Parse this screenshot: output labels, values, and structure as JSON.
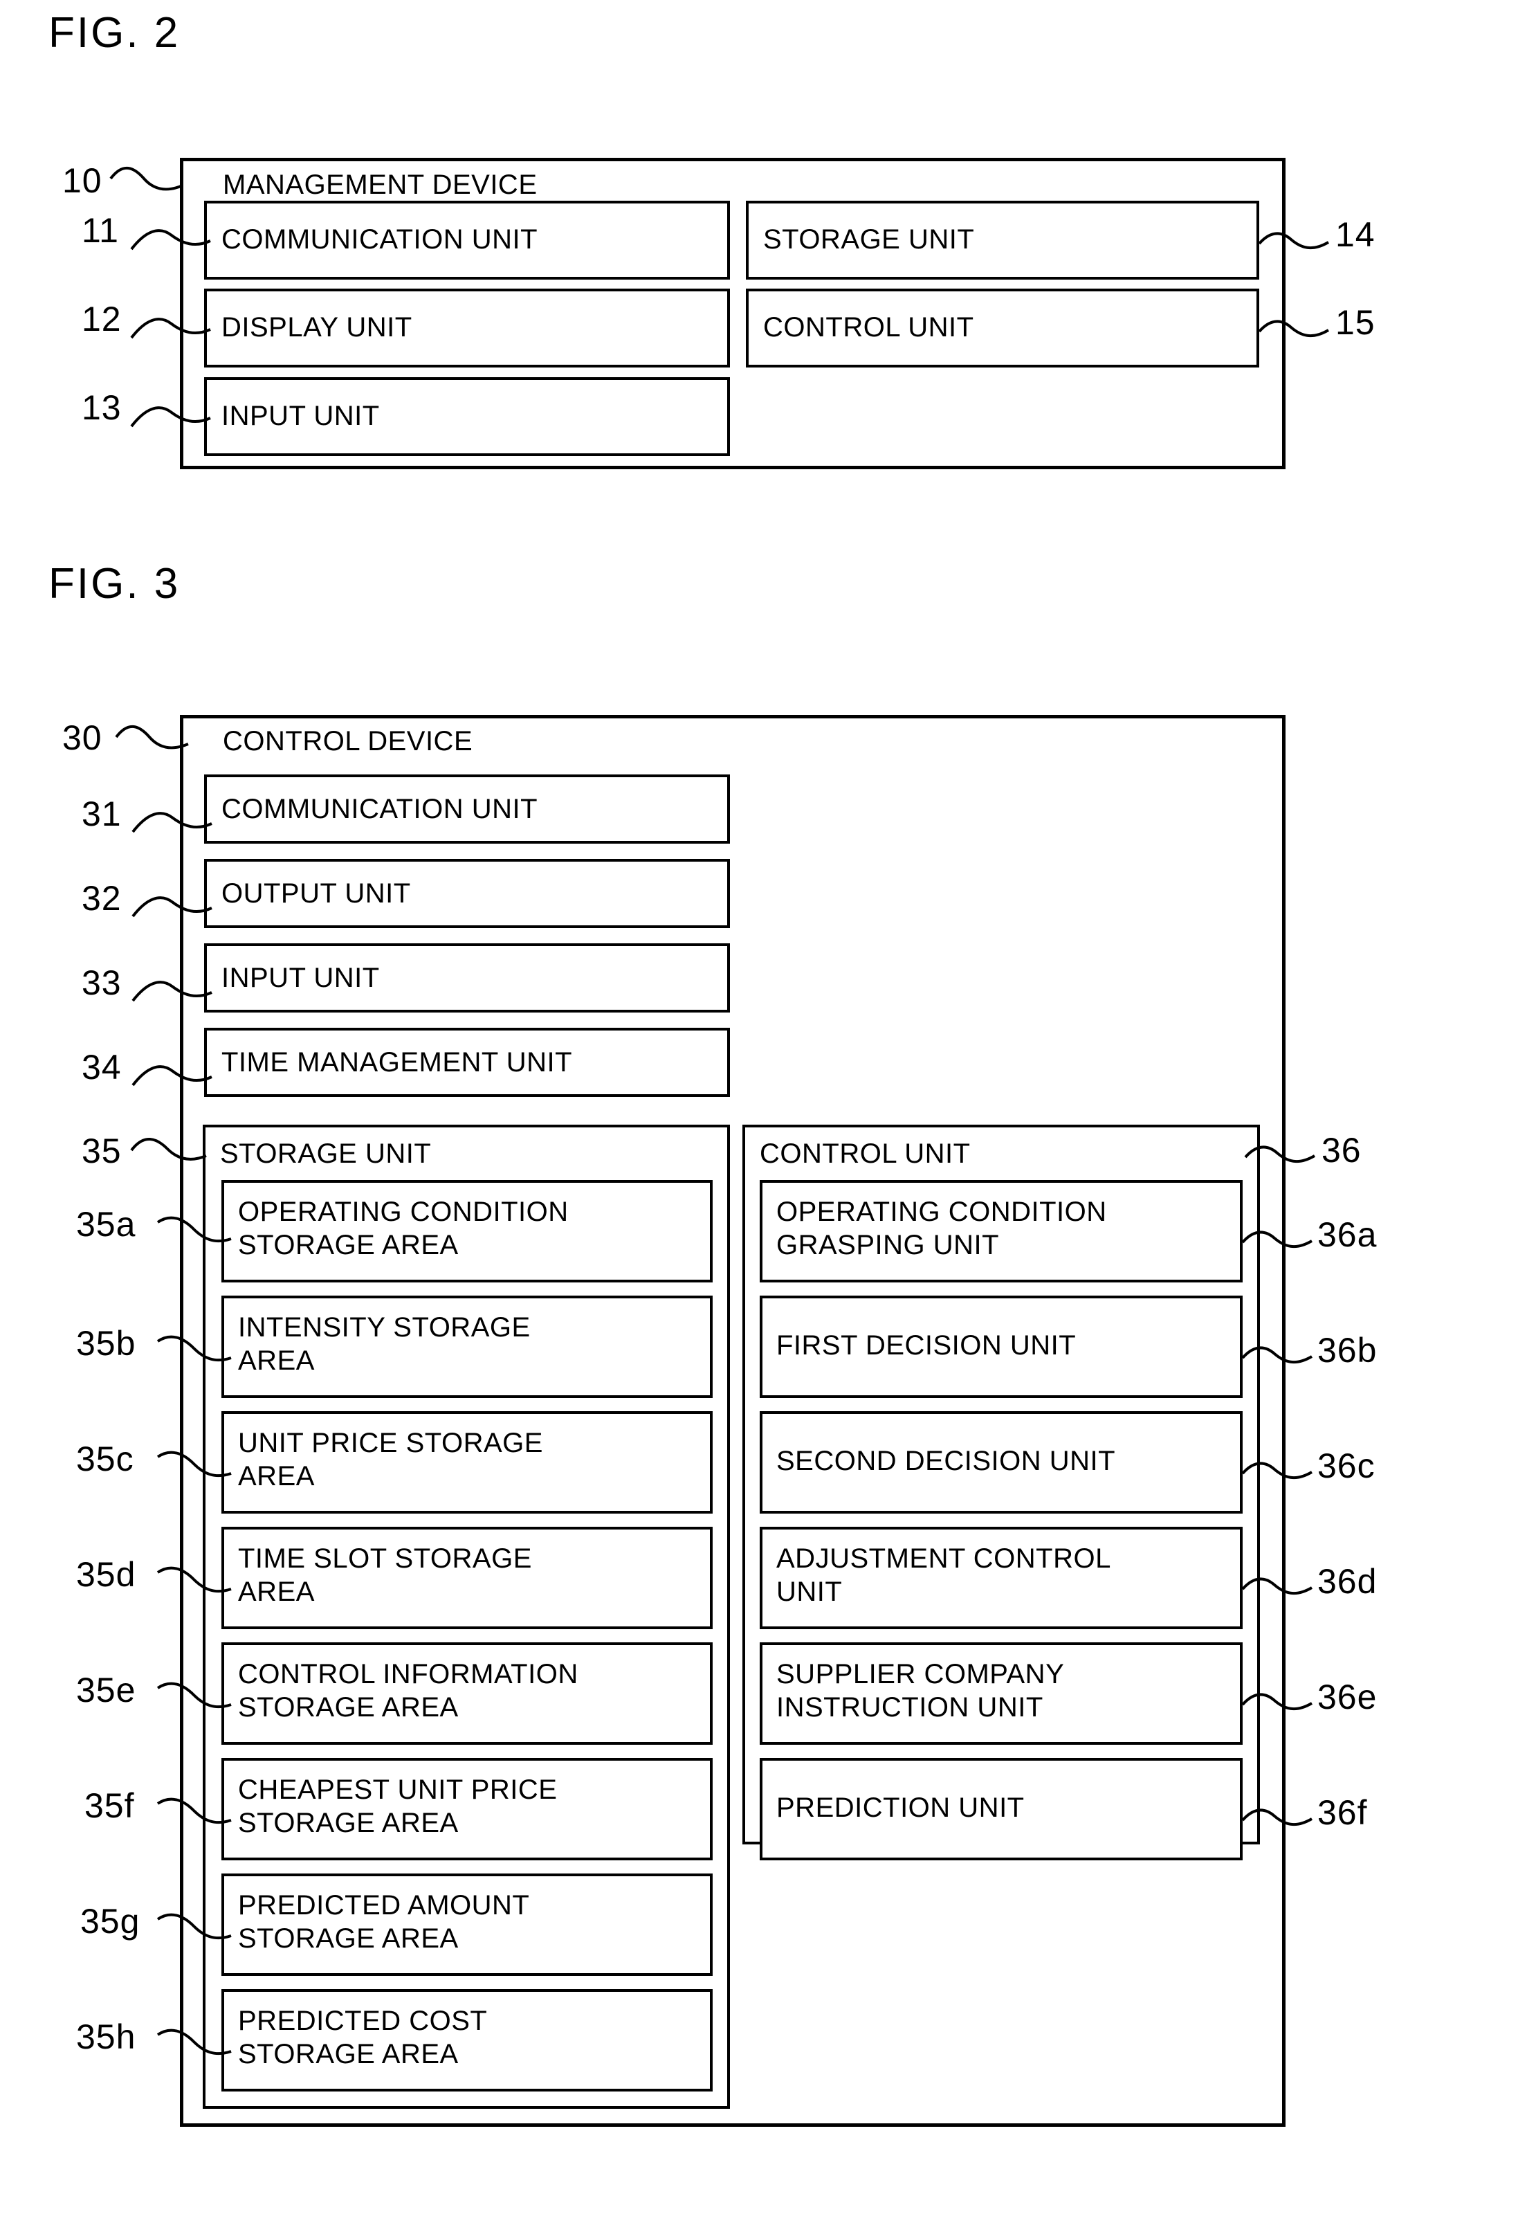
{
  "figures": [
    {
      "title": "FIG. 2",
      "device": {
        "ref": "10",
        "name": "MANAGEMENT DEVICE",
        "units": [
          {
            "ref": "11",
            "label": "COMMUNICATION UNIT",
            "column": "left"
          },
          {
            "ref": "12",
            "label": "DISPLAY UNIT",
            "column": "left"
          },
          {
            "ref": "13",
            "label": "INPUT UNIT",
            "column": "left"
          },
          {
            "ref": "14",
            "label": "STORAGE UNIT",
            "column": "right"
          },
          {
            "ref": "15",
            "label": "CONTROL UNIT",
            "column": "right"
          }
        ]
      }
    },
    {
      "title": "FIG. 3",
      "device": {
        "ref": "30",
        "name": "CONTROL DEVICE",
        "units": [
          {
            "ref": "31",
            "label": "COMMUNICATION UNIT"
          },
          {
            "ref": "32",
            "label": "OUTPUT UNIT"
          },
          {
            "ref": "33",
            "label": "INPUT UNIT"
          },
          {
            "ref": "34",
            "label": "TIME MANAGEMENT UNIT"
          }
        ],
        "storage_unit": {
          "ref": "35",
          "name": "STORAGE UNIT",
          "areas": [
            {
              "ref": "35a",
              "line1": "OPERATING CONDITION",
              "line2": "STORAGE AREA"
            },
            {
              "ref": "35b",
              "line1": "INTENSITY STORAGE",
              "line2": "AREA"
            },
            {
              "ref": "35c",
              "line1": "UNIT PRICE STORAGE",
              "line2": "AREA"
            },
            {
              "ref": "35d",
              "line1": "TIME SLOT STORAGE",
              "line2": "AREA"
            },
            {
              "ref": "35e",
              "line1": "CONTROL INFORMATION",
              "line2": "STORAGE AREA"
            },
            {
              "ref": "35f",
              "line1": "CHEAPEST UNIT PRICE",
              "line2": "STORAGE AREA"
            },
            {
              "ref": "35g",
              "line1": "PREDICTED AMOUNT",
              "line2": "STORAGE AREA"
            },
            {
              "ref": "35h",
              "line1": "PREDICTED COST",
              "line2": "STORAGE AREA"
            }
          ]
        },
        "control_unit": {
          "ref": "36",
          "name": "CONTROL UNIT",
          "units": [
            {
              "ref": "36a",
              "line1": "OPERATING CONDITION",
              "line2": "GRASPING UNIT"
            },
            {
              "ref": "36b",
              "line1": "FIRST DECISION UNIT",
              "line2": ""
            },
            {
              "ref": "36c",
              "line1": "SECOND DECISION UNIT",
              "line2": ""
            },
            {
              "ref": "36d",
              "line1": "ADJUSTMENT CONTROL",
              "line2": "UNIT"
            },
            {
              "ref": "36e",
              "line1": "SUPPLIER COMPANY",
              "line2": "INSTRUCTION UNIT"
            },
            {
              "ref": "36f",
              "line1": "PREDICTION UNIT",
              "line2": ""
            }
          ]
        }
      }
    }
  ],
  "colors": {
    "ink": "#000000",
    "paper": "#ffffff"
  }
}
